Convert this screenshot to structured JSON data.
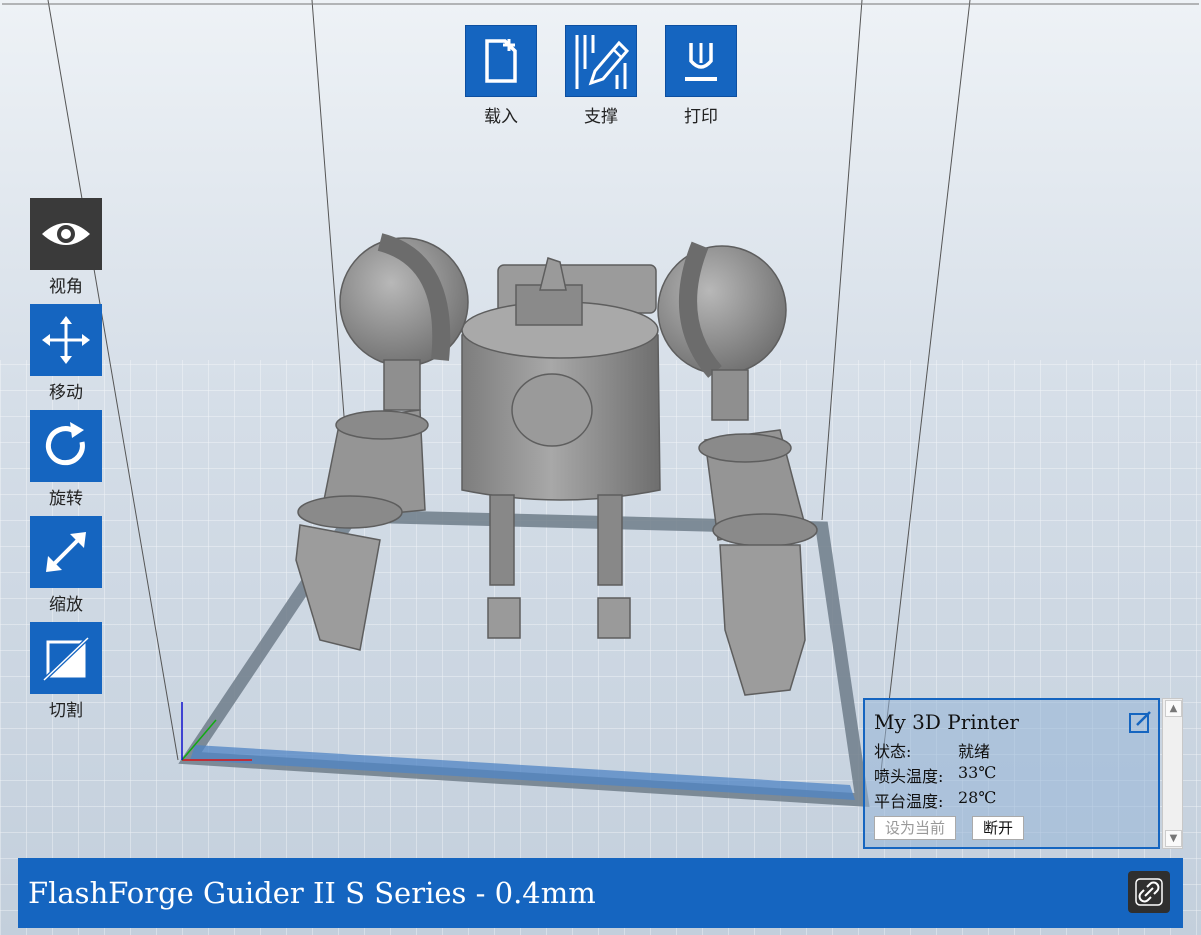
{
  "toolbar": {
    "load": {
      "label": "载入",
      "icon": "file-add-icon"
    },
    "support": {
      "label": "支撑",
      "icon": "pencil-support-icon"
    },
    "print": {
      "label": "打印",
      "icon": "print-icon"
    }
  },
  "side_tools": [
    {
      "label": "视角",
      "icon": "eye-icon",
      "active": true
    },
    {
      "label": "移动",
      "icon": "move-arrows-icon",
      "active": false
    },
    {
      "label": "旋转",
      "icon": "rotate-icon",
      "active": false
    },
    {
      "label": "缩放",
      "icon": "scale-diagonal-icon",
      "active": false
    },
    {
      "label": "切割",
      "icon": "cut-icon",
      "active": false
    }
  ],
  "printer_panel": {
    "title": "My 3D Printer",
    "status_label": "状态:",
    "status_value": "就绪",
    "nozzle_label": "喷头温度:",
    "nozzle_value": "33℃",
    "bed_label": "平台温度:",
    "bed_value": "28℃",
    "set_current_button": "设为当前",
    "disconnect_button": "断开"
  },
  "footer": {
    "printer_name": "FlashForge Guider II S Series - 0.4mm"
  },
  "colors": {
    "accent": "#1565c0",
    "active_tool": "#3a3a3a",
    "model": "#8c8c8c"
  }
}
